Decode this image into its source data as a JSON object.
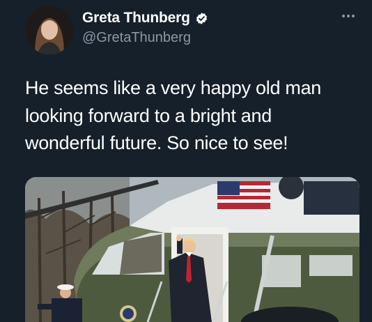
{
  "author": {
    "display_name": "Greta Thunberg",
    "handle": "@GretaThunberg",
    "verified": true
  },
  "tweet": {
    "text_lines": [
      "He seems like a very happy old man",
      "looking forward to a bright and",
      "wonderful future. So nice to see!"
    ]
  },
  "media": {
    "description": "photo"
  },
  "icons": {
    "verified": "verified-badge-icon",
    "more": "more-options-icon"
  },
  "colors": {
    "background": "#15202b",
    "text": "#ffffff",
    "secondary_text": "#8b98a5"
  }
}
